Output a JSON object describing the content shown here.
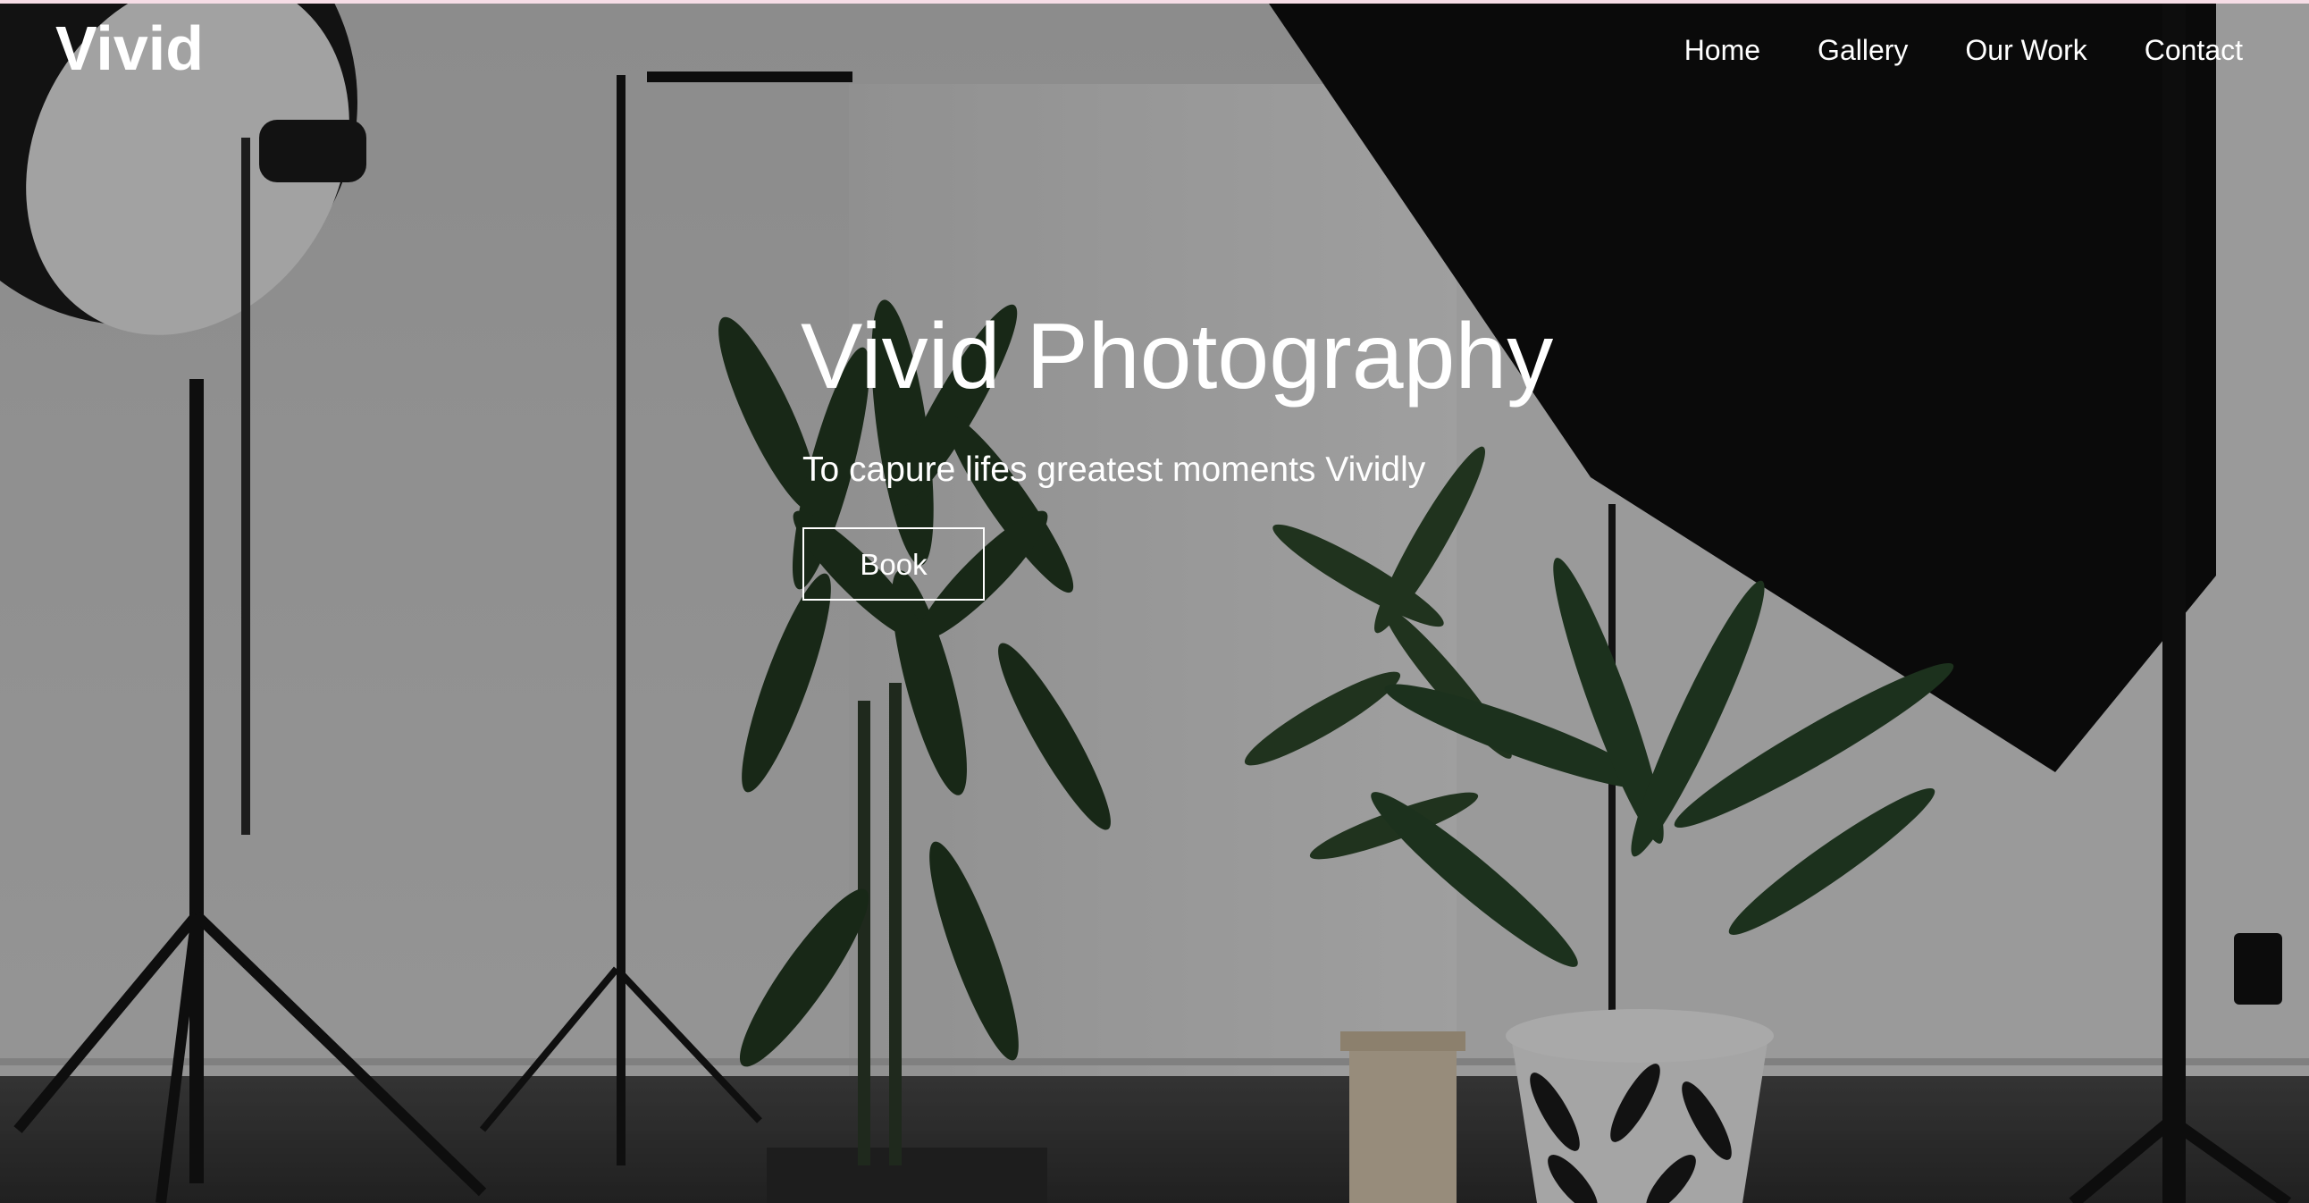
{
  "brand": {
    "logo": "Vivid"
  },
  "nav": {
    "items": [
      {
        "label": "Home"
      },
      {
        "label": "Gallery"
      },
      {
        "label": "Our Work"
      },
      {
        "label": "Contact"
      }
    ]
  },
  "hero": {
    "title": "Vivid Photography",
    "tagline": "To capure lifes greatest moments Vividly",
    "button_label": "Book",
    "background_image": "photo-studio-with-lights-and-plants"
  },
  "colors": {
    "text": "#ffffff",
    "overlay": "#000000",
    "top_strip": "#f6dde6"
  }
}
